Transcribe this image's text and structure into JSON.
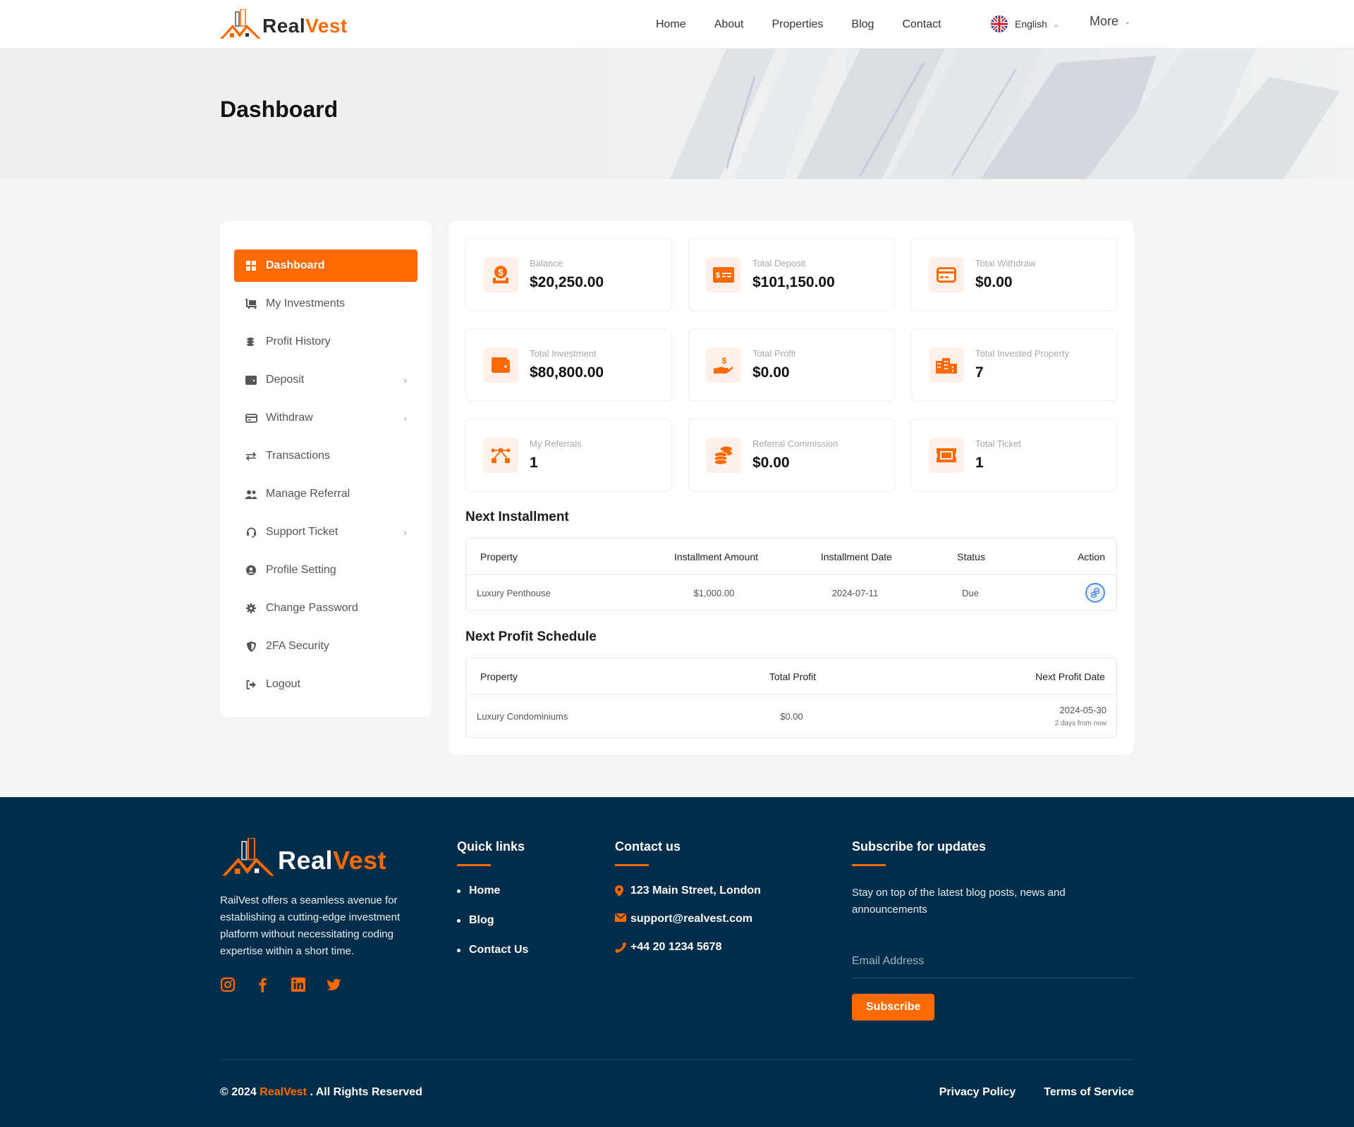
{
  "brand": {
    "name_part1": "Real",
    "name_part2": "Vest",
    "accent": "#ff6a00",
    "dark": "#002d49"
  },
  "nav": {
    "links": [
      "Home",
      "About",
      "Properties",
      "Blog",
      "Contact"
    ],
    "language": "English",
    "more": "More"
  },
  "hero": {
    "title": "Dashboard"
  },
  "sidebar": {
    "items": [
      {
        "label": "Dashboard",
        "icon": "grid-icon",
        "active": true,
        "has_submenu": false
      },
      {
        "label": "My Investments",
        "icon": "investment-cart-icon",
        "active": false,
        "has_submenu": false
      },
      {
        "label": "Profit History",
        "icon": "coins-icon",
        "active": false,
        "has_submenu": false
      },
      {
        "label": "Deposit",
        "icon": "wallet-icon",
        "active": false,
        "has_submenu": true
      },
      {
        "label": "Withdraw",
        "icon": "credit-card-icon",
        "active": false,
        "has_submenu": true
      },
      {
        "label": "Transactions",
        "icon": "exchange-icon",
        "active": false,
        "has_submenu": false
      },
      {
        "label": "Manage Referral",
        "icon": "users-icon",
        "active": false,
        "has_submenu": false
      },
      {
        "label": "Support Ticket",
        "icon": "headset-icon",
        "active": false,
        "has_submenu": true
      },
      {
        "label": "Profile Setting",
        "icon": "user-circle-icon",
        "active": false,
        "has_submenu": false
      },
      {
        "label": "Change Password",
        "icon": "gear-icon",
        "active": false,
        "has_submenu": false
      },
      {
        "label": "2FA Security",
        "icon": "shield-icon",
        "active": false,
        "has_submenu": false
      },
      {
        "label": "Logout",
        "icon": "logout-icon",
        "active": false,
        "has_submenu": false
      }
    ]
  },
  "stats": [
    {
      "label": "Balance",
      "value": "$20,250.00",
      "icon": "money-bag-icon"
    },
    {
      "label": "Total Deposit",
      "value": "$101,150.00",
      "icon": "money-check-icon"
    },
    {
      "label": "Total Withdraw",
      "value": "$0.00",
      "icon": "credit-card-icon"
    },
    {
      "label": "Total Investment",
      "value": "$80,800.00",
      "icon": "wallet-icon"
    },
    {
      "label": "Total Profit",
      "value": "$0.00",
      "icon": "hand-dollar-icon"
    },
    {
      "label": "Total Invested Property",
      "value": "7",
      "icon": "building-icon"
    },
    {
      "label": "My Referrals",
      "value": "1",
      "icon": "network-icon"
    },
    {
      "label": "Referral Commission",
      "value": "$0.00",
      "icon": "coins-stack-icon"
    },
    {
      "label": "Total Ticket",
      "value": "1",
      "icon": "ticket-icon"
    }
  ],
  "installment": {
    "title": "Next Installment",
    "headers": [
      "Property",
      "Installment Amount",
      "Installment Date",
      "Status",
      "Action"
    ],
    "rows": [
      {
        "property": "Luxury Penthouse",
        "amount": "$1,000.00",
        "date": "2024-07-11",
        "status": "Due"
      }
    ]
  },
  "profit_schedule": {
    "title": "Next Profit Schedule",
    "headers": [
      "Property",
      "Total Profit",
      "Next Profit Date"
    ],
    "rows": [
      {
        "property": "Luxury Condominiums",
        "profit": "$0.00",
        "date": "2024-05-30",
        "relative": "2 days from now"
      }
    ]
  },
  "footer": {
    "description": "RailVest offers a seamless avenue for establishing a cutting-edge investment platform without necessitating coding expertise within a short time.",
    "social": [
      "instagram-icon",
      "facebook-icon",
      "linkedin-icon",
      "twitter-icon"
    ],
    "quick_links": {
      "title": "Quick links",
      "items": [
        "Home",
        "Blog",
        "Contact Us"
      ]
    },
    "contact": {
      "title": "Contact us",
      "address": "123 Main Street, London",
      "email": "support@realvest.com",
      "phone": "+44 20 1234 5678"
    },
    "subscribe": {
      "title": "Subscribe for updates",
      "text": "Stay on top of the latest blog posts, news and announcements",
      "placeholder": "Email Address",
      "button": "Subscribe"
    },
    "copyright_prefix": "© 2024",
    "copyright_brand": "RealVest",
    "copyright_suffix": ". All Rights Reserved",
    "links": [
      "Privacy Policy",
      "Terms of Service"
    ]
  }
}
